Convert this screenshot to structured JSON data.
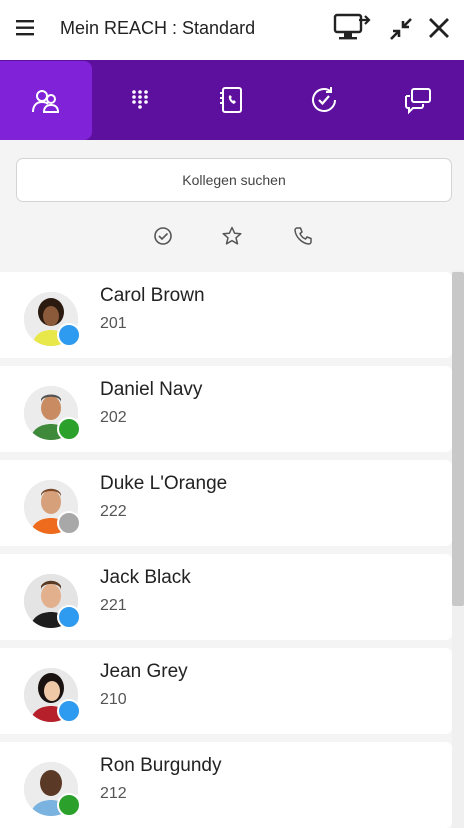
{
  "titlebar": {
    "title": "Mein REACH : Standard",
    "icons": [
      "hamburger-menu-icon",
      "screen-share-icon",
      "collapse-icon",
      "close-icon"
    ]
  },
  "nav": {
    "tabs": [
      {
        "name": "contacts",
        "icon": "people-icon",
        "active": true
      },
      {
        "name": "dialpad",
        "icon": "dialpad-icon",
        "active": false
      },
      {
        "name": "phonebook",
        "icon": "phonebook-icon",
        "active": false
      },
      {
        "name": "history",
        "icon": "history-icon",
        "active": false
      },
      {
        "name": "chat",
        "icon": "chat-icon",
        "active": false
      }
    ]
  },
  "search": {
    "placeholder": "Kollegen suchen"
  },
  "filters": [
    "available-filter-icon",
    "favorites-star-icon",
    "phone-filter-icon"
  ],
  "colors": {
    "nav_bg": "#5d0f9e",
    "nav_active": "#8023d8",
    "status_blue": "#2f9bf0",
    "status_green": "#2ba12b",
    "status_gray": "#a8a8a8"
  },
  "contacts": [
    {
      "name": "Carol Brown",
      "ext": "201",
      "status": "blue"
    },
    {
      "name": "Daniel Navy",
      "ext": "202",
      "status": "green"
    },
    {
      "name": "Duke L'Orange",
      "ext": "222",
      "status": "gray"
    },
    {
      "name": "Jack Black",
      "ext": "221",
      "status": "blue"
    },
    {
      "name": "Jean Grey",
      "ext": "210",
      "status": "blue"
    },
    {
      "name": "Ron Burgundy",
      "ext": "212",
      "status": "green"
    }
  ]
}
